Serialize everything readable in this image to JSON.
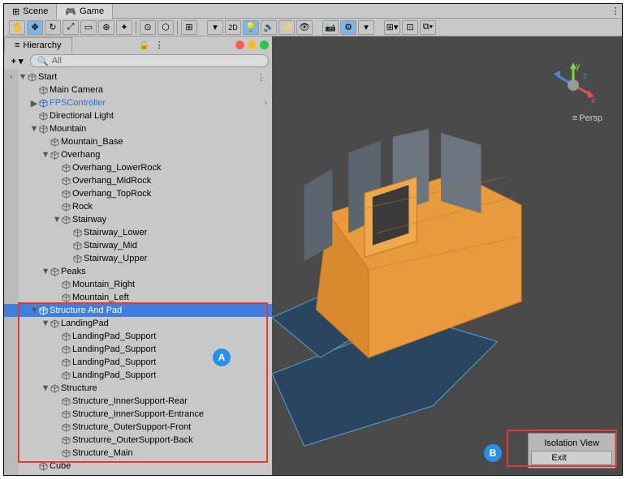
{
  "tabs": {
    "scene": "Scene",
    "game": "Game"
  },
  "hierarchy": {
    "title": "Hierarchy",
    "search_placeholder": "All",
    "root": "Start",
    "items": [
      {
        "depth": 1,
        "arrow": "",
        "label": "Main Camera"
      },
      {
        "depth": 1,
        "arrow": "▶",
        "label": "FPSController",
        "blue": true,
        "chev": true
      },
      {
        "depth": 1,
        "arrow": "",
        "label": "Directional Light"
      },
      {
        "depth": 1,
        "arrow": "▼",
        "label": "Mountain"
      },
      {
        "depth": 2,
        "arrow": "",
        "label": "Mountain_Base"
      },
      {
        "depth": 2,
        "arrow": "▼",
        "label": "Overhang"
      },
      {
        "depth": 3,
        "arrow": "",
        "label": "Overhang_LowerRock"
      },
      {
        "depth": 3,
        "arrow": "",
        "label": "Overhang_MidRock"
      },
      {
        "depth": 3,
        "arrow": "",
        "label": "Overhang_TopRock"
      },
      {
        "depth": 3,
        "arrow": "",
        "label": "Rock"
      },
      {
        "depth": 3,
        "arrow": "▼",
        "label": "Stairway"
      },
      {
        "depth": 4,
        "arrow": "",
        "label": "Stairway_Lower"
      },
      {
        "depth": 4,
        "arrow": "",
        "label": "Stairway_Mid"
      },
      {
        "depth": 4,
        "arrow": "",
        "label": "Stairway_Upper"
      },
      {
        "depth": 2,
        "arrow": "▼",
        "label": "Peaks"
      },
      {
        "depth": 3,
        "arrow": "",
        "label": "Mountain_Right"
      },
      {
        "depth": 3,
        "arrow": "",
        "label": "Mountain_Left"
      },
      {
        "depth": 1,
        "arrow": "▼",
        "label": "Structure And Pad",
        "selected": true
      },
      {
        "depth": 2,
        "arrow": "▼",
        "label": "LandingPad"
      },
      {
        "depth": 3,
        "arrow": "",
        "label": "LandingPad_Support"
      },
      {
        "depth": 3,
        "arrow": "",
        "label": "LandingPad_Support"
      },
      {
        "depth": 3,
        "arrow": "",
        "label": "LandingPad_Support"
      },
      {
        "depth": 3,
        "arrow": "",
        "label": "LandingPad_Support"
      },
      {
        "depth": 2,
        "arrow": "▼",
        "label": "Structure"
      },
      {
        "depth": 3,
        "arrow": "",
        "label": "Structure_InnerSupport-Rear"
      },
      {
        "depth": 3,
        "arrow": "",
        "label": "Structure_InnerSupport-Entrance"
      },
      {
        "depth": 3,
        "arrow": "",
        "label": "Structure_OuterSupport-Front"
      },
      {
        "depth": 3,
        "arrow": "",
        "label": "Structurre_OuterSupport-Back"
      },
      {
        "depth": 3,
        "arrow": "",
        "label": "Structure_Main"
      },
      {
        "depth": 1,
        "arrow": "",
        "label": "Cube"
      }
    ]
  },
  "viewport": {
    "perspective_label": "Persp",
    "axes": {
      "x": "x",
      "y": "y",
      "z": "z"
    },
    "isolation": {
      "title": "Isolation View",
      "exit": "Exit"
    }
  },
  "annotations": {
    "a": "A",
    "b": "B"
  }
}
